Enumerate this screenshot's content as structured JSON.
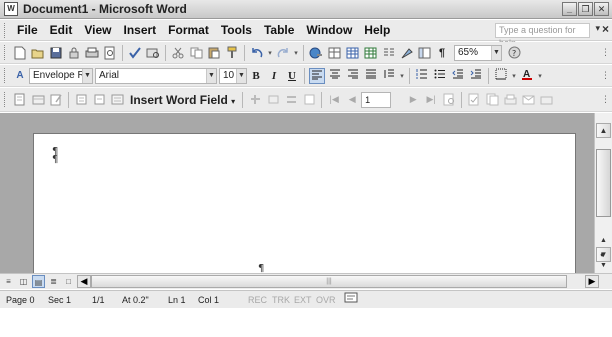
{
  "window": {
    "app_icon_glyph": "W",
    "title": "Document1 - Microsoft Word",
    "controls": {
      "minimize": "_",
      "restore": "❐",
      "close": "✕"
    }
  },
  "menu": {
    "items": [
      {
        "label": "File"
      },
      {
        "label": "Edit"
      },
      {
        "label": "View"
      },
      {
        "label": "Insert"
      },
      {
        "label": "Format"
      },
      {
        "label": "Tools"
      },
      {
        "label": "Table"
      },
      {
        "label": "Window"
      },
      {
        "label": "Help"
      }
    ],
    "help_placeholder": "Type a question for help",
    "help_arrow": "▾",
    "close_glyph": "×"
  },
  "standard_toolbar": {
    "icons": [
      "new-document-icon",
      "open-icon",
      "save-icon",
      "permission-icon",
      "print-icon",
      "print-preview-icon",
      "spelling-icon",
      "research-icon",
      "cut-icon",
      "copy-icon",
      "paste-icon",
      "format-painter-icon",
      "undo-icon",
      "redo-icon",
      "hyperlink-icon",
      "tables-borders-icon",
      "insert-table-icon",
      "excel-icon",
      "columns-icon",
      "drawing-icon",
      "document-map-icon",
      "show-hide-icon"
    ],
    "show_hide_glyph": "¶",
    "zoom": "65%",
    "help_glyph": "?"
  },
  "formatting_toolbar": {
    "style": "Envelope Retur",
    "font": "Arial",
    "font_size": "10",
    "bold": "B",
    "italic": "I",
    "underline": "U"
  },
  "mail_merge_toolbar": {
    "insert_word_field": "Insert Word Field",
    "record_number": "1"
  },
  "document": {
    "paragraph_mark": "¶"
  },
  "statusbar": {
    "page": "Page 0",
    "section": "Sec 1",
    "page_of": "1/1",
    "at": "At 0.2\"",
    "line": "Ln 1",
    "column": "Col 1",
    "rec": "REC",
    "trk": "TRK",
    "ext": "EXT",
    "ovr": "OVR"
  },
  "colors": {
    "chrome": "#ebebeb",
    "workspace": "#a8a8a8",
    "selected": "#c9dbf1"
  }
}
